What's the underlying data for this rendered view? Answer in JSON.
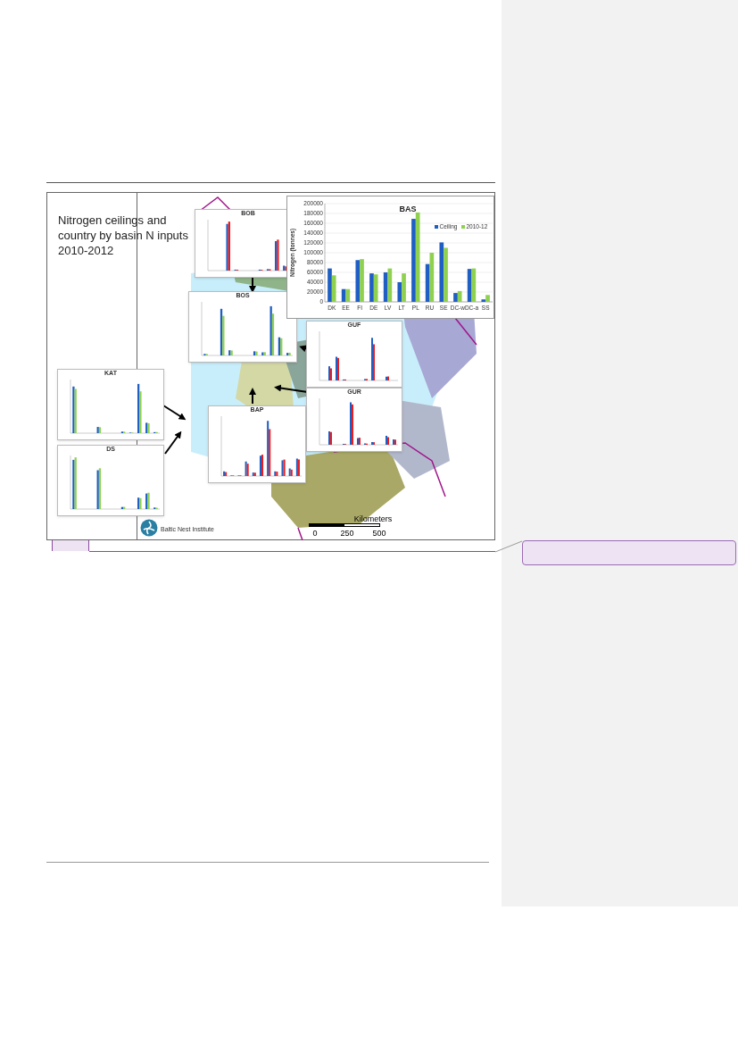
{
  "figure": {
    "caption": "Nitrogen ceilings and country by basin N inputs 2010-2012",
    "main_chart": {
      "chart_data": {
        "type": "bar",
        "title": "BAS",
        "ylabel": "Nitrogen (tonnes)",
        "categories": [
          "DK",
          "EE",
          "FI",
          "DE",
          "LV",
          "LT",
          "PL",
          "RU",
          "SE",
          "DC-w",
          "DC-a",
          "SS"
        ],
        "series": [
          {
            "name": "Ceiling",
            "color": "#1f5fc4",
            "values": [
              68000,
              26000,
              85000,
              58000,
              60000,
              40000,
              169000,
              77000,
              121000,
              18000,
              67000,
              5000
            ]
          },
          {
            "name": "2010-12",
            "color": "#8fd14f",
            "values": [
              54000,
              26000,
              87000,
              56000,
              68000,
              58000,
              182000,
              100000,
              110000,
              22000,
              68000,
              14000
            ]
          }
        ],
        "grid": true,
        "legend": true,
        "ylim": [
          0,
          200000
        ],
        "yticks": [
          0,
          20000,
          40000,
          60000,
          80000,
          100000,
          120000,
          140000,
          160000,
          180000,
          200000
        ]
      }
    },
    "inset_charts": [
      {
        "title": "BOB"
      },
      {
        "title": "BOS"
      },
      {
        "title": "GUF"
      },
      {
        "title": "GUR"
      },
      {
        "title": "KAT"
      },
      {
        "title": "DS"
      },
      {
        "title": "BAP"
      }
    ],
    "scale_bar": {
      "unit": "Kilometers",
      "ticks": [
        "0",
        "250",
        "500"
      ]
    },
    "logo_text": "Baltic Nest Institute"
  }
}
